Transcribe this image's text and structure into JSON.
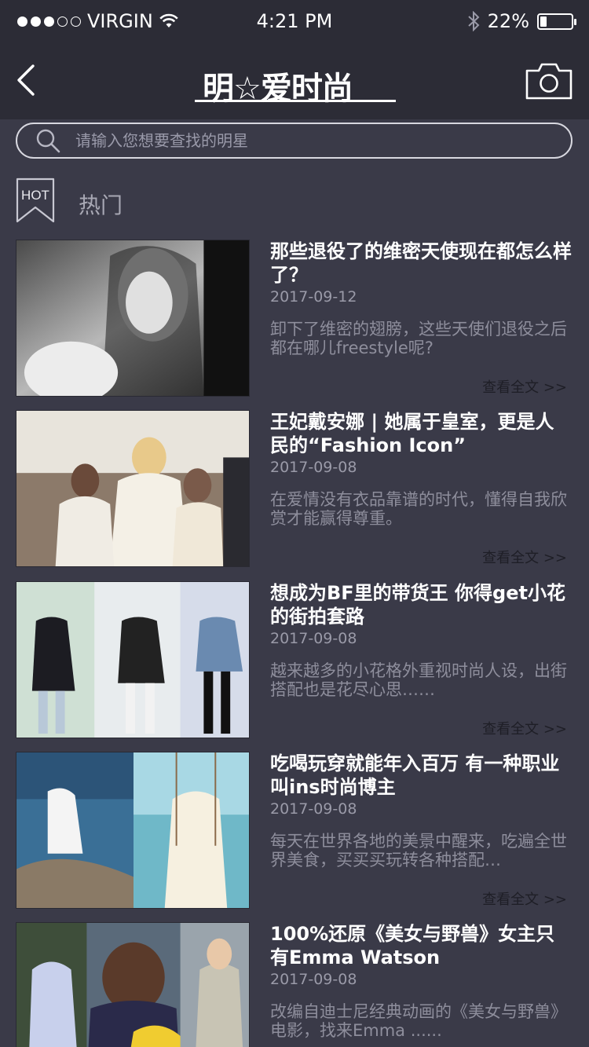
{
  "status_bar": {
    "carrier": "VIRGIN",
    "time": "4:21 PM",
    "battery": "22%",
    "battery_level": 0.22,
    "signal_bars": 3
  },
  "nav": {
    "logo_text": "明☆爱时尚"
  },
  "search": {
    "placeholder": "请输入您想要查找的明星"
  },
  "section": {
    "badge": "HOT",
    "title": "热门"
  },
  "articles": [
    {
      "title": "那些退役了的维密天使现在都怎么样了？",
      "date": "2017-09-12",
      "summary": "卸下了维密的翅膀，这些天使们退役之后都在哪儿freestyle呢?",
      "read_more": "查看全文 >>"
    },
    {
      "title": "王妃戴安娜 | 她属于皇室，更是人民的“Fashion Icon”",
      "date": "2017-09-08",
      "summary": "在爱情没有衣品靠谱的时代，懂得自我欣赏才能赢得尊重。",
      "read_more": "查看全文 >>"
    },
    {
      "title": "想成为BF里的带货王 你得get小花的街拍套路",
      "date": "2017-09-08",
      "summary": "越来越多的小花格外重视时尚人设，出街搭配也是花尽心思……",
      "read_more": "查看全文 >>"
    },
    {
      "title": "吃喝玩穿就能年入百万 有一种职业叫ins时尚博主",
      "date": "2017-09-08",
      "summary": "每天在世界各地的美景中醒来，吃遍全世界美食，买买买玩转各种搭配…",
      "read_more": "查看全文 >>"
    },
    {
      "title": "100%还原《美女与野兽》女主只有Emma Watson",
      "date": "2017-09-08",
      "summary": "改编自迪士尼经典动画的《美女与野兽》电影，找来Emma ......",
      "read_more": ""
    }
  ]
}
